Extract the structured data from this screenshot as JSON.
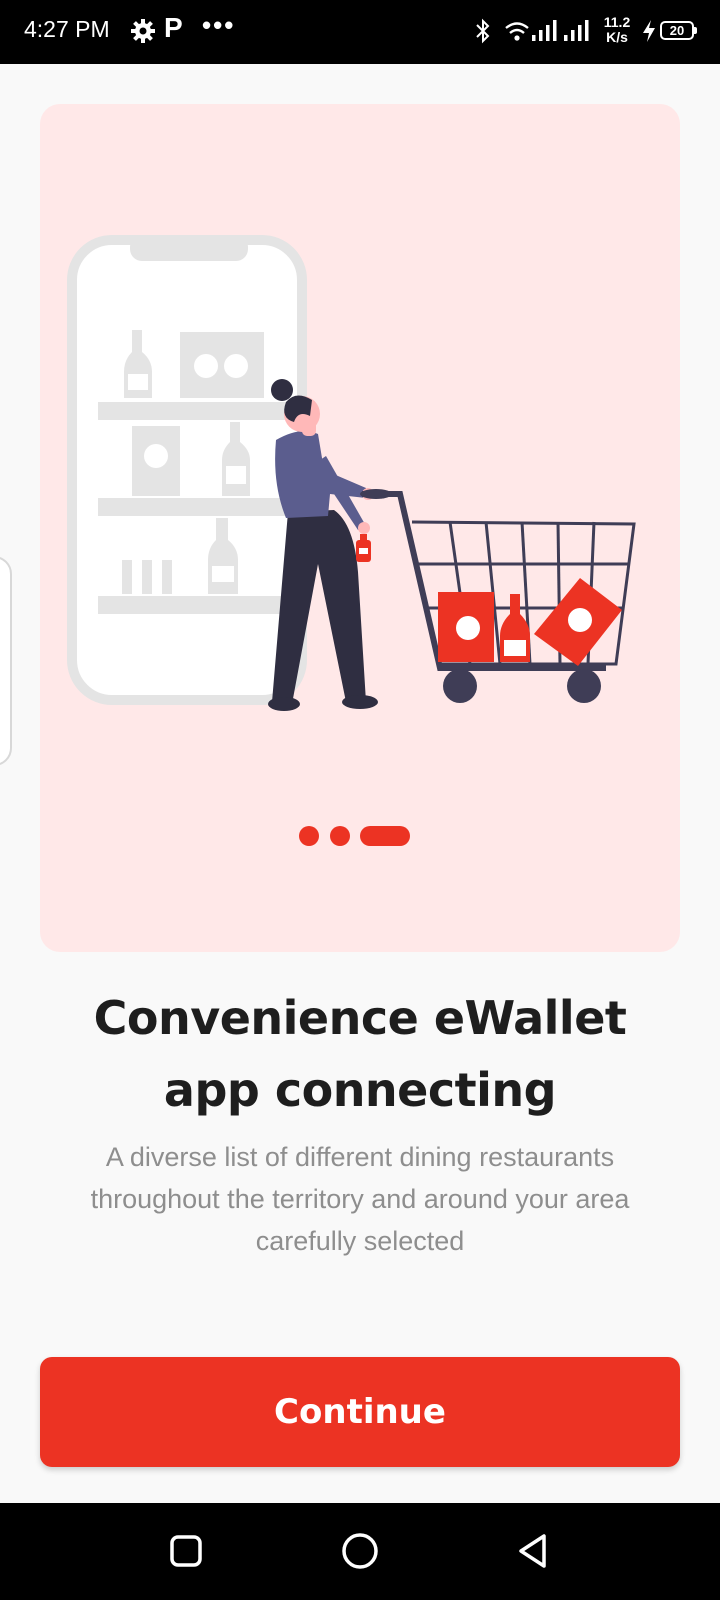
{
  "status_bar": {
    "time": "4:27 PM",
    "notification_letter": "P",
    "more": "•••",
    "speed_value": "11.2",
    "speed_unit": "K/s",
    "battery": "20",
    "icons": [
      "gear-icon",
      "bluetooth-icon",
      "wifi-icon",
      "signal-icon",
      "signal-icon",
      "charging-icon",
      "battery-icon"
    ]
  },
  "onboarding": {
    "illustration": "woman-pushing-shopping-cart",
    "page_count": 3,
    "active_page": 3,
    "title": "Convenience eWallet app connecting",
    "description": "A diverse list of different dining restaurants throughout the territory and around your area carefully selected",
    "continue_label": "Continue"
  },
  "colors": {
    "accent": "#ec3323",
    "card_background": "#ffe8e8",
    "page_background": "#f9f9f9",
    "title_text": "#1e1e1e",
    "body_text": "#8e8e8e",
    "figure_shirt": "#5b5d8e",
    "figure_dark": "#2f2e41"
  },
  "nav_bar": {
    "buttons": [
      "recents-icon",
      "home-icon",
      "back-icon"
    ]
  }
}
